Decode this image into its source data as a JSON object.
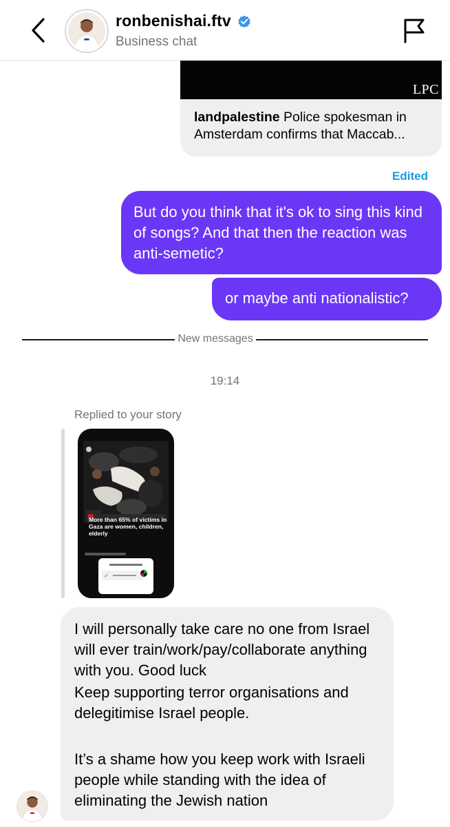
{
  "header": {
    "username": "ronbenishai.ftv",
    "subtitle": "Business chat",
    "verified": true,
    "icons": {
      "back": "chevron-left-icon",
      "flag": "flag-icon",
      "verified": "verified-badge-icon"
    }
  },
  "shared_post": {
    "watermark": "LPC",
    "account": "landpalestine",
    "caption": " Police spokesman in Amsterdam confirms that Maccab..."
  },
  "edited_label": "Edited",
  "outgoing_messages": [
    "But do you think that it's ok to sing this kind of songs? And that then the reaction was anti-semetic?",
    "or maybe anti nationalistic?"
  ],
  "divider_label": "New messages",
  "timestamp": "19:14",
  "story_reply": {
    "label": "Replied to your story",
    "story_headline": "More than 65% of victims in Gaza are women, children, elderly"
  },
  "incoming_message": {
    "line1": "I will personally take care no one from Israel will ever train/work/pay/collaborate anything with you. Good luck",
    "line2": "Keep supporting terror organisations and delegitimise Israel people.",
    "line3": "It’s a shame how you keep work with Israeli people while standing with the idea of eliminating the Jewish nation"
  },
  "colors": {
    "outgoing_bubble": "#6a37f6",
    "incoming_bubble": "#efefef",
    "edited_text": "#1a9ae0",
    "verified_badge": "#3797f0"
  }
}
